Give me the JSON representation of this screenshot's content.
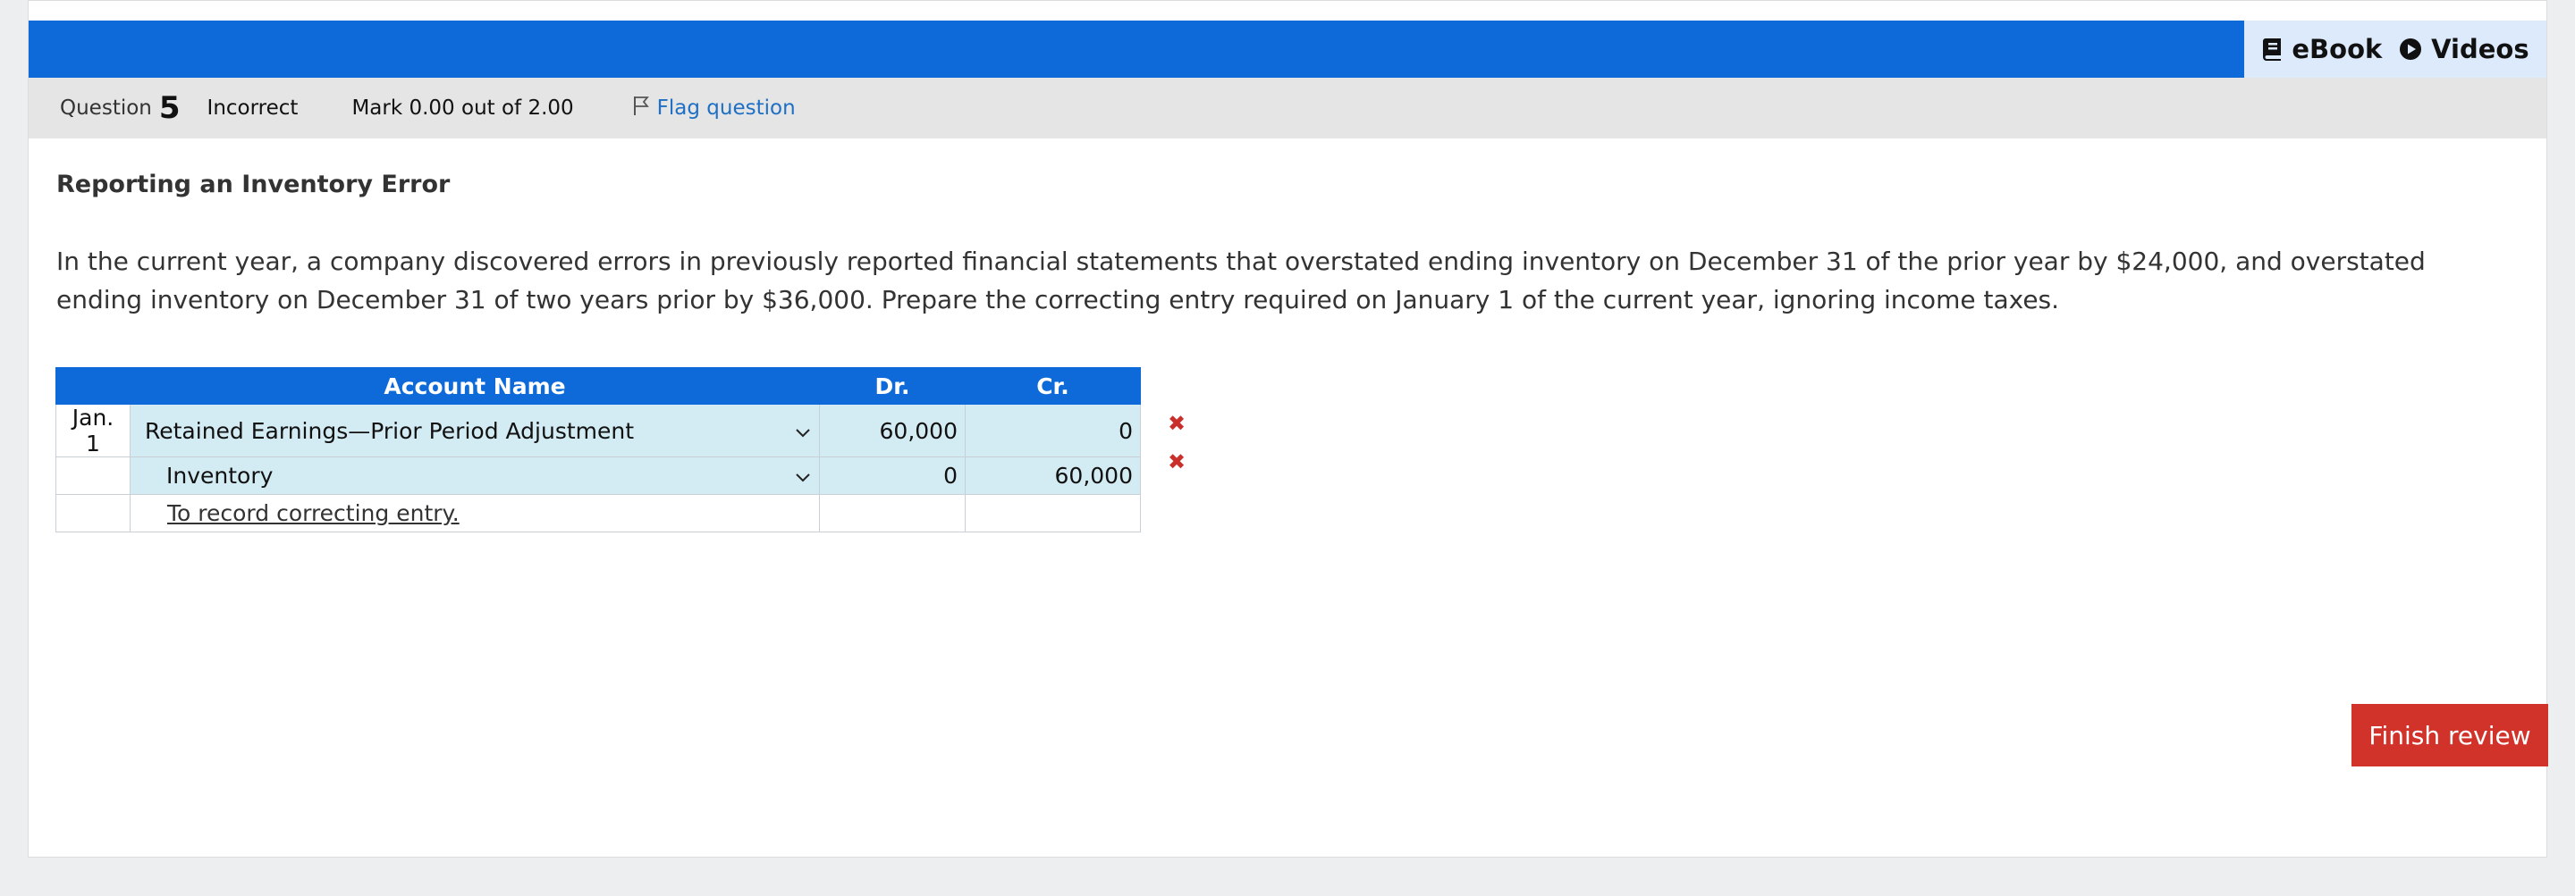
{
  "resources": {
    "ebook_label": "eBook",
    "videos_label": "Videos"
  },
  "question": {
    "label": "Question",
    "number": "5",
    "status": "Incorrect",
    "mark": "Mark 0.00 out of 2.00",
    "flag_label": "Flag question"
  },
  "title": "Reporting an Inventory Error",
  "prompt": "In the current year, a company discovered errors in previously reported financial statements that overstated ending inventory on December 31 of the prior year by $24,000, and overstated ending inventory on December 31 of two years prior by $36,000. Prepare the correcting entry required on January 1 of the current year, ignoring income taxes.",
  "journal": {
    "headers": {
      "account": "Account Name",
      "dr": "Dr.",
      "cr": "Cr."
    },
    "rows": [
      {
        "date": "Jan. 1",
        "account": "Retained Earnings—Prior Period Adjustment",
        "dr": "60,000",
        "cr": "0",
        "mark": "✖"
      },
      {
        "date": "",
        "account": "Inventory",
        "dr": "0",
        "cr": "60,000",
        "mark": "✖"
      }
    ],
    "memo": "To record correcting entry."
  },
  "finish_label": "Finish review",
  "colors": {
    "header_blue": "#0e6ad9",
    "filled_cell": "#d3ebf2",
    "error_red": "#c9302c",
    "button_red": "#d1322a"
  }
}
